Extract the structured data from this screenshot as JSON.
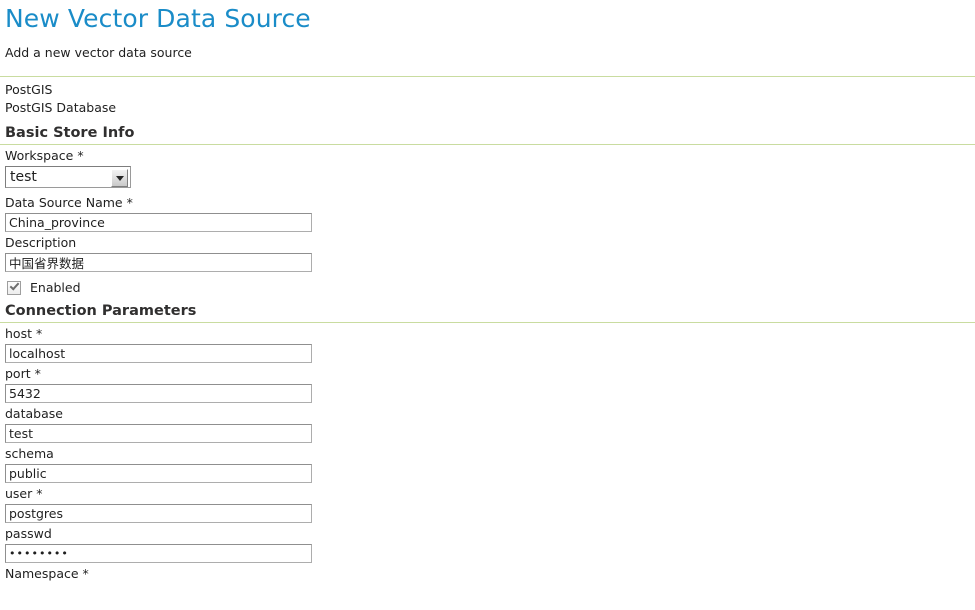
{
  "header": {
    "title": "New Vector Data Source",
    "subtitle": "Add a new vector data source"
  },
  "store_type": {
    "name": "PostGIS",
    "description": "PostGIS Database"
  },
  "sections": {
    "basic_store_info": {
      "heading": "Basic Store Info",
      "workspace": {
        "label": "Workspace",
        "required": "*",
        "value": "test"
      },
      "data_source_name": {
        "label": "Data Source Name",
        "required": "*",
        "value": "China_province"
      },
      "description": {
        "label": "Description",
        "required": "",
        "value": "中国省界数据"
      },
      "enabled": {
        "label": "Enabled",
        "checked": true
      }
    },
    "connection_parameters": {
      "heading": "Connection Parameters",
      "fields": [
        {
          "label": "host",
          "required": "*",
          "value": "localhost"
        },
        {
          "label": "port",
          "required": "*",
          "value": "5432"
        },
        {
          "label": "database",
          "required": "",
          "value": "test"
        },
        {
          "label": "schema",
          "required": "",
          "value": "public"
        },
        {
          "label": "user",
          "required": "*",
          "value": "postgres"
        },
        {
          "label": "passwd",
          "required": "",
          "value": "••••••••",
          "type": "password"
        },
        {
          "label": "Namespace",
          "required": "*",
          "value": ""
        }
      ]
    }
  },
  "colors": {
    "title_blue": "#1a8cc8",
    "rule_green": "#c9dca0",
    "text": "#1f1f1f",
    "heading": "#302f2f"
  }
}
